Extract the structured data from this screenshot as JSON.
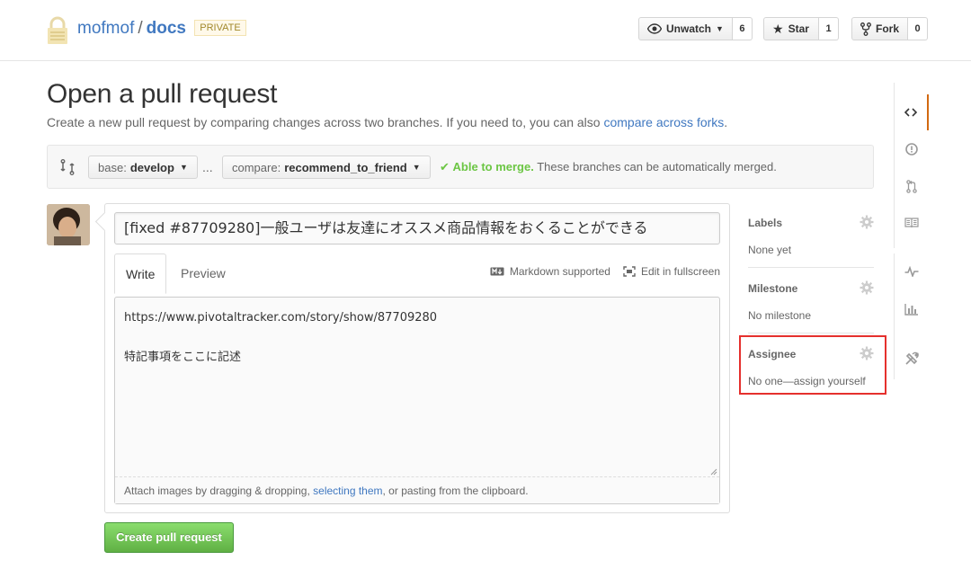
{
  "repo": {
    "owner": "mofmof",
    "separator": "/",
    "name": "docs",
    "visibility": "PRIVATE"
  },
  "actions": {
    "watch": {
      "label": "Unwatch",
      "count": "6"
    },
    "star": {
      "label": "Star",
      "count": "1"
    },
    "fork": {
      "label": "Fork",
      "count": "0"
    }
  },
  "page": {
    "title": "Open a pull request",
    "description": "Create a new pull request by comparing changes across two branches. If you need to, you can also ",
    "description_link": "compare across forks",
    "description_end": "."
  },
  "range": {
    "base_prefix": "base:",
    "base_branch": "develop",
    "ellipsis": "...",
    "compare_prefix": "compare:",
    "compare_branch": "recommend_to_friend",
    "merge_status": "Able to merge.",
    "merge_message": "These branches can be automatically merged."
  },
  "form": {
    "title_value": "[fixed #87709280]一般ユーザは友達にオススメ商品情報をおくることができる",
    "tab_write": "Write",
    "tab_preview": "Preview",
    "markdown_label": "Markdown supported",
    "fullscreen_label": "Edit in fullscreen",
    "body_value": "https://www.pivotaltracker.com/story/show/87709280\n\n特記事項をここに記述",
    "drop_text_before": "Attach images by dragging & dropping, ",
    "drop_link": "selecting them",
    "drop_text_after": ", or pasting from the clipboard.",
    "submit_label": "Create pull request"
  },
  "sidebar": {
    "labels": {
      "heading": "Labels",
      "value": "None yet"
    },
    "milestone": {
      "heading": "Milestone",
      "value": "No milestone"
    },
    "assignee": {
      "heading": "Assignee",
      "value": "No one—assign yourself"
    }
  },
  "colors": {
    "link": "#4078c0",
    "success": "#6cc644",
    "button_green": "#60b044",
    "highlight": "#e5302d",
    "nav_selected": "#d26911"
  },
  "icons": [
    "lock-icon",
    "eye-icon",
    "star-icon",
    "fork-icon",
    "compare-icon",
    "check-icon",
    "markdown-icon",
    "fullscreen-icon",
    "gear-icon",
    "code-icon",
    "issue-icon",
    "pull-request-icon",
    "wiki-icon",
    "pulse-icon",
    "graph-icon",
    "settings-icon"
  ]
}
